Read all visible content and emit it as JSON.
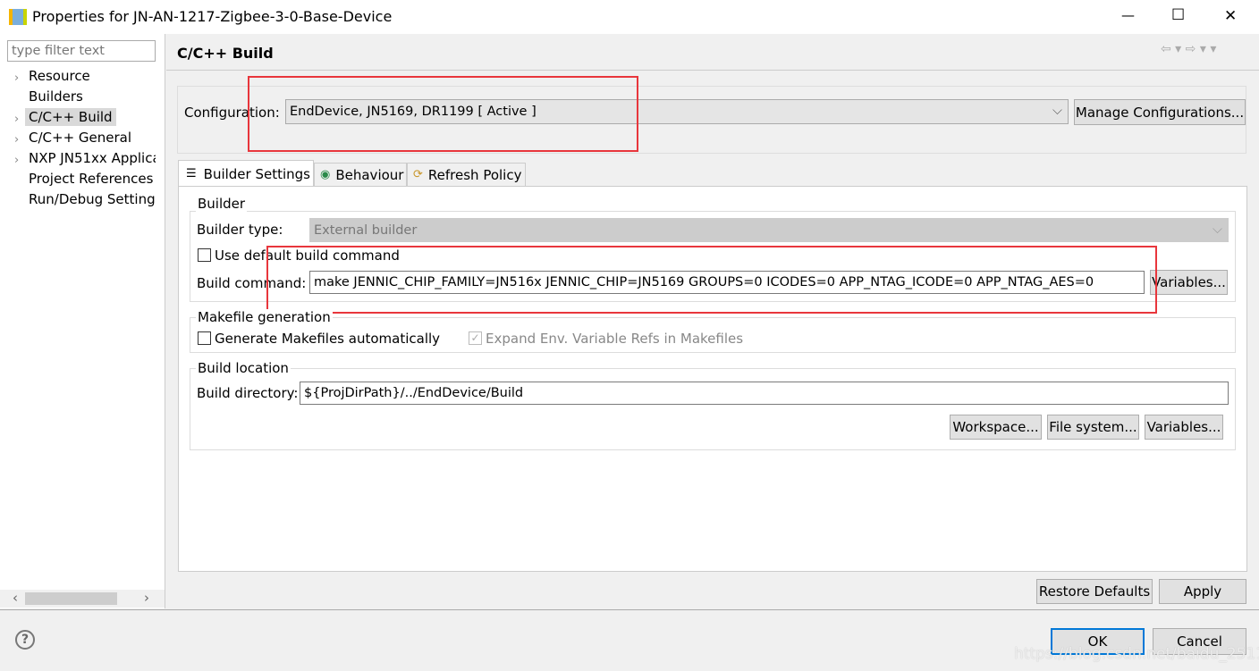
{
  "window": {
    "title": "Properties for JN-AN-1217-Zigbee-3-0-Base-Device",
    "minimize": "—",
    "maximize": "☐",
    "close": "✕"
  },
  "sidebar": {
    "filter_placeholder": "type filter text",
    "items": [
      {
        "label": "Resource",
        "expandable": true
      },
      {
        "label": "Builders",
        "expandable": false
      },
      {
        "label": "C/C++ Build",
        "expandable": true,
        "selected": true
      },
      {
        "label": "C/C++ General",
        "expandable": true
      },
      {
        "label": "NXP JN51xx Applica",
        "expandable": true
      },
      {
        "label": "Project References",
        "expandable": false
      },
      {
        "label": "Run/Debug Settings",
        "expandable": false
      }
    ]
  },
  "page": {
    "title": "C/C++ Build",
    "configuration_label": "Configuration:",
    "configuration_value": "EndDevice, JN5169, DR1199  [ Active ]",
    "manage_button": "Manage Configurations...",
    "tabs": [
      {
        "label": "Builder Settings",
        "icon": "list-icon",
        "active": true
      },
      {
        "label": "Behaviour",
        "icon": "radio-icon"
      },
      {
        "label": "Refresh Policy",
        "icon": "refresh-icon"
      }
    ],
    "builder": {
      "legend": "Builder",
      "type_label": "Builder type:",
      "type_value": "External builder",
      "use_default_label": "Use default build command",
      "use_default_checked": false,
      "command_label": "Build command:",
      "command_value": "make JENNIC_CHIP_FAMILY=JN516x JENNIC_CHIP=JN5169 GROUPS=0 ICODES=0 APP_NTAG_ICODE=0 APP_NTAG_AES=0",
      "variables_button": "Variables..."
    },
    "makefile": {
      "legend": "Makefile generation",
      "generate_label": "Generate Makefiles automatically",
      "generate_checked": false,
      "expand_label": "Expand Env. Variable Refs in Makefiles",
      "expand_checked": true
    },
    "location": {
      "legend": "Build location",
      "dir_label": "Build directory:",
      "dir_value": "${ProjDirPath}/../EndDevice/Build",
      "workspace_button": "Workspace...",
      "filesystem_button": "File system...",
      "variables_button": "Variables..."
    },
    "restore_button": "Restore Defaults",
    "apply_button": "Apply"
  },
  "footer": {
    "help": "?",
    "ok_button": "OK",
    "cancel_button": "Cancel"
  },
  "watermark": "https://blog.csdn.net/baidu_25117757",
  "colors": {
    "highlight": "#e8363c",
    "selection": "#d9d9d9",
    "focus": "#0078d7"
  }
}
